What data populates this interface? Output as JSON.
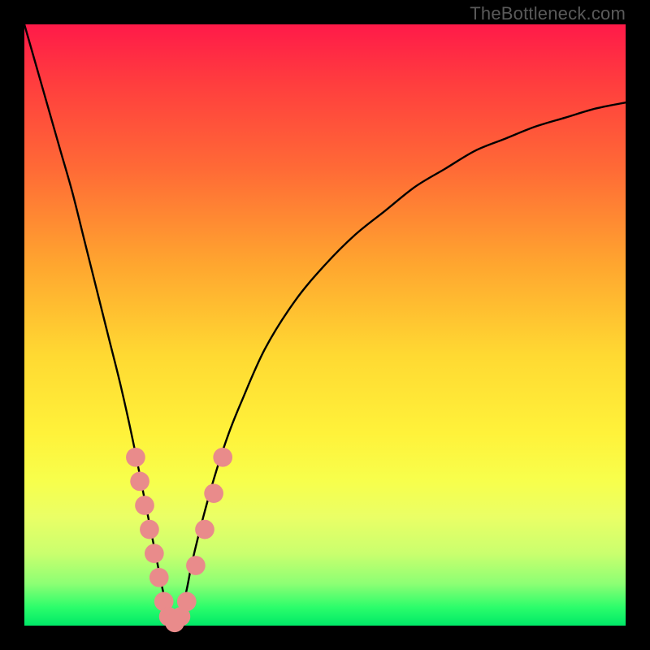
{
  "watermark": "TheBottleneck.com",
  "colors": {
    "curve": "#000000",
    "marker_fill": "#e98b8b",
    "marker_stroke": "#e98b8b"
  },
  "chart_data": {
    "type": "line",
    "title": "",
    "xlabel": "",
    "ylabel": "",
    "xlim": [
      0,
      100
    ],
    "ylim": [
      0,
      100
    ],
    "series": [
      {
        "name": "bottleneck-curve",
        "x": [
          0,
          2,
          4,
          6,
          8,
          10,
          12,
          14,
          16,
          18,
          20,
          21,
          22,
          23,
          24,
          25,
          26,
          27,
          28,
          30,
          32,
          34,
          36,
          40,
          45,
          50,
          55,
          60,
          65,
          70,
          75,
          80,
          85,
          90,
          95,
          100
        ],
        "y": [
          100,
          93,
          86,
          79,
          72,
          64,
          56,
          48,
          40,
          31,
          21,
          16,
          11,
          6,
          2,
          0,
          2,
          6,
          11,
          19,
          26,
          32,
          37,
          46,
          54,
          60,
          65,
          69,
          73,
          76,
          79,
          81,
          83,
          84.5,
          86,
          87
        ]
      }
    ],
    "markers": [
      {
        "x": 18.5,
        "y": 28,
        "r": 1.6
      },
      {
        "x": 19.2,
        "y": 24,
        "r": 1.6
      },
      {
        "x": 20.0,
        "y": 20,
        "r": 1.6
      },
      {
        "x": 20.8,
        "y": 16,
        "r": 1.6
      },
      {
        "x": 21.6,
        "y": 12,
        "r": 1.6
      },
      {
        "x": 22.4,
        "y": 8,
        "r": 1.6
      },
      {
        "x": 23.2,
        "y": 4,
        "r": 1.6
      },
      {
        "x": 24.0,
        "y": 1.5,
        "r": 1.6
      },
      {
        "x": 25.0,
        "y": 0.5,
        "r": 1.6
      },
      {
        "x": 26.0,
        "y": 1.5,
        "r": 1.6
      },
      {
        "x": 27.0,
        "y": 4,
        "r": 1.6
      },
      {
        "x": 28.5,
        "y": 10,
        "r": 1.6
      },
      {
        "x": 30.0,
        "y": 16,
        "r": 1.6
      },
      {
        "x": 31.5,
        "y": 22,
        "r": 1.6
      },
      {
        "x": 33.0,
        "y": 28,
        "r": 1.6
      }
    ]
  }
}
